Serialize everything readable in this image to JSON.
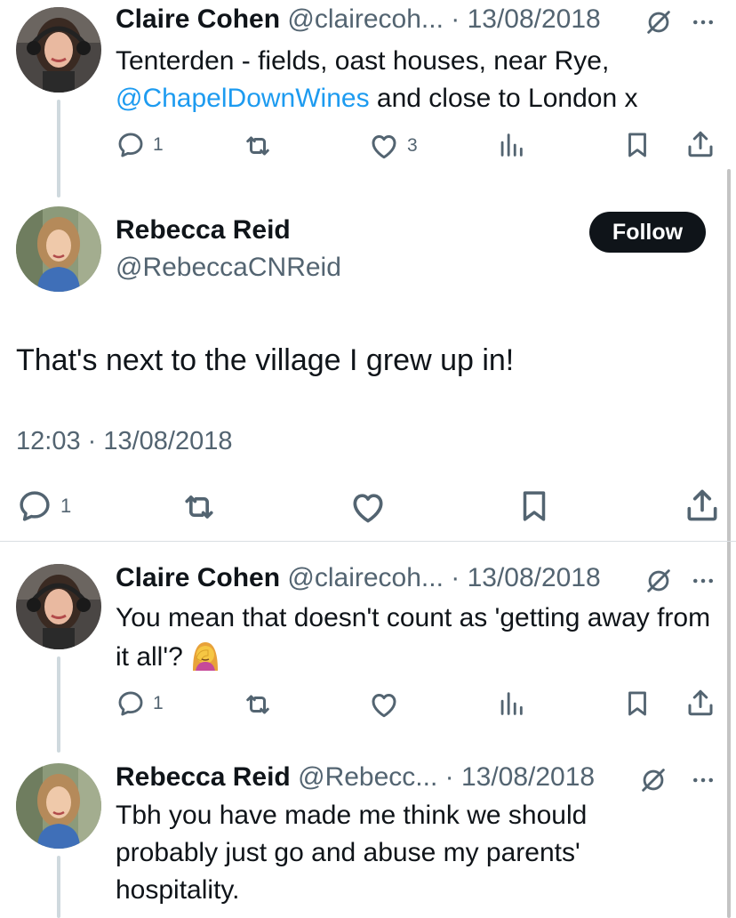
{
  "tweets": [
    {
      "name": "Claire Cohen",
      "handle": "@clairecoh...",
      "date": "· 13/08/2018",
      "text_before": "Tenterden - fields, oast houses, near Rye, ",
      "mention": "@ChapelDownWines",
      "text_after": " and close to London x",
      "replies": "1",
      "likes": "3",
      "avatar_icon": "avatar-claire"
    },
    {
      "name": "Rebecca Reid",
      "handle": "@RebeccaCNReid",
      "follow_label": "Follow",
      "text": "That's next to the village I grew up in!",
      "timestamp": "12:03 · 13/08/2018",
      "replies": "1",
      "avatar_icon": "avatar-rebecca"
    },
    {
      "name": "Claire Cohen",
      "handle": "@clairecoh...",
      "date": "· 13/08/2018",
      "text": "You mean that doesn't count as 'getting away from it all'?",
      "emoji": "woman-facepalming",
      "replies": "1",
      "avatar_icon": "avatar-claire"
    },
    {
      "name": "Rebecca Reid",
      "handle": "@Rebecc...",
      "date": "· 13/08/2018",
      "text": "Tbh you have made me think we should probably just go and abuse my parents' hospitality.",
      "avatar_icon": "avatar-rebecca"
    }
  ],
  "colors": {
    "text": "#0f1419",
    "muted": "#536471",
    "link": "#1d9bf0",
    "follow_bg": "#0f1419",
    "thread_line": "#cfd9de"
  }
}
